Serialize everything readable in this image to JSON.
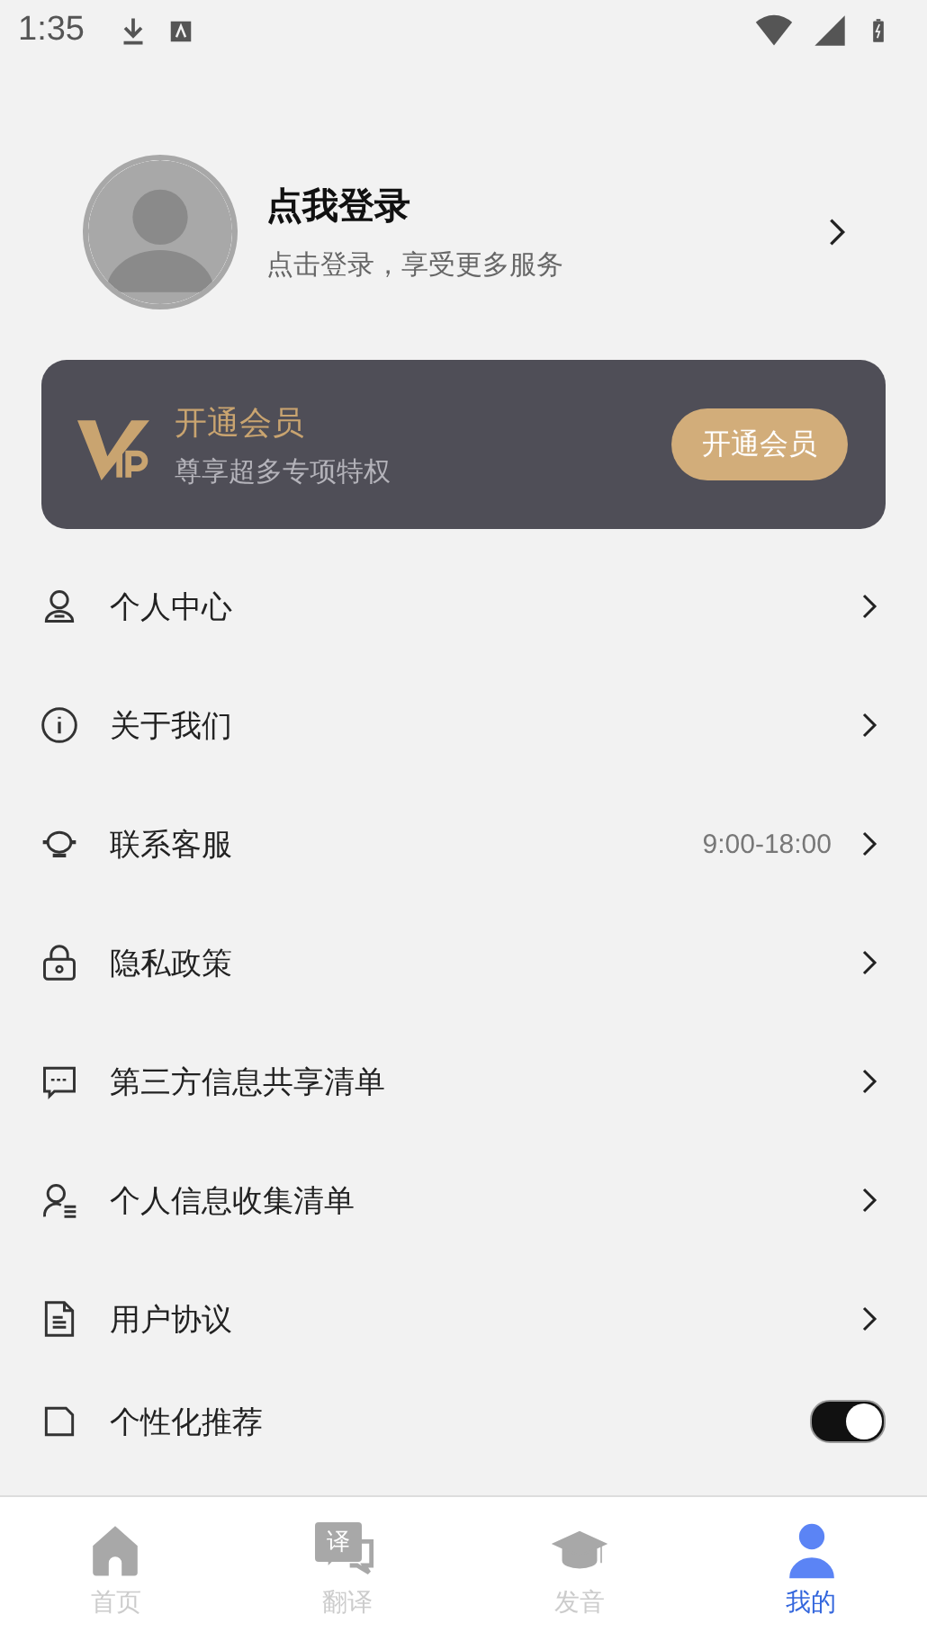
{
  "status_bar": {
    "time": "1:35"
  },
  "profile": {
    "title": "点我登录",
    "subtitle": "点击登录，享受更多服务"
  },
  "vip": {
    "title": "开通会员",
    "subtitle": "尊享超多专项特权",
    "button": "开通会员"
  },
  "menu": [
    {
      "kind": "link",
      "label": "个人中心"
    },
    {
      "kind": "link",
      "label": "关于我们"
    },
    {
      "kind": "link",
      "label": "联系客服",
      "value": "9:00-18:00"
    },
    {
      "kind": "link",
      "label": "隐私政策"
    },
    {
      "kind": "link",
      "label": "第三方信息共享清单"
    },
    {
      "kind": "link",
      "label": "个人信息收集清单"
    },
    {
      "kind": "link",
      "label": "用户协议"
    },
    {
      "kind": "toggle",
      "label": "个性化推荐",
      "on": true
    }
  ],
  "tabs": [
    {
      "label": "首页",
      "selected": false
    },
    {
      "label": "翻译",
      "selected": false,
      "icon_text": "译"
    },
    {
      "label": "发音",
      "selected": false
    },
    {
      "label": "我的",
      "selected": true
    }
  ]
}
